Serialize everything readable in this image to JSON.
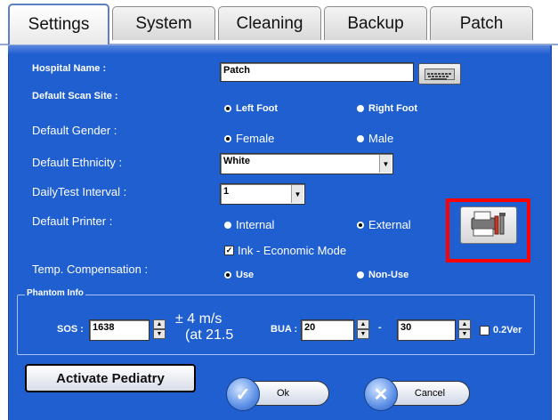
{
  "tabs": [
    "Settings",
    "System",
    "Cleaning",
    "Backup",
    "Patch"
  ],
  "fields": {
    "hospital_name_label": "Hospital Name :",
    "hospital_name_value": "Patch",
    "scan_site_label": "Default Scan Site :",
    "scan_site_options": [
      "Left Foot",
      "Right Foot"
    ],
    "gender_label": "Default Gender :",
    "gender_options": [
      "Female",
      "Male"
    ],
    "ethnicity_label": "Default Ethnicity :",
    "ethnicity_value": "White",
    "dailytest_label": "DailyTest Interval :",
    "dailytest_value": "1",
    "printer_label": "Default Printer :",
    "printer_options": [
      "Internal",
      "External"
    ],
    "ink_label": "Ink - Economic Mode",
    "temp_label": "Temp. Compensation :",
    "temp_options": [
      "Use",
      "Non-Use"
    ]
  },
  "phantom": {
    "title": "Phantom Info",
    "sos_label": "SOS :",
    "sos_value": "1638",
    "tolerance_line1": "± 4 m/s",
    "tolerance_line2": "(at 21.5",
    "bua_label": "BUA :",
    "bua_min": "20",
    "dash": "-",
    "bua_max": "30",
    "ver_label": "0.2Ver"
  },
  "buttons": {
    "pediatry": "Activate Pediatry",
    "ok": "Ok",
    "cancel": "Cancel"
  },
  "icons": {
    "keyboard": "keyboard-icon",
    "printer_settings": "printer-settings-icon",
    "ok": "checkmark-icon",
    "cancel": "x-icon"
  },
  "colors": {
    "panel": "#1f5fd0",
    "highlight": "#ff0000"
  }
}
